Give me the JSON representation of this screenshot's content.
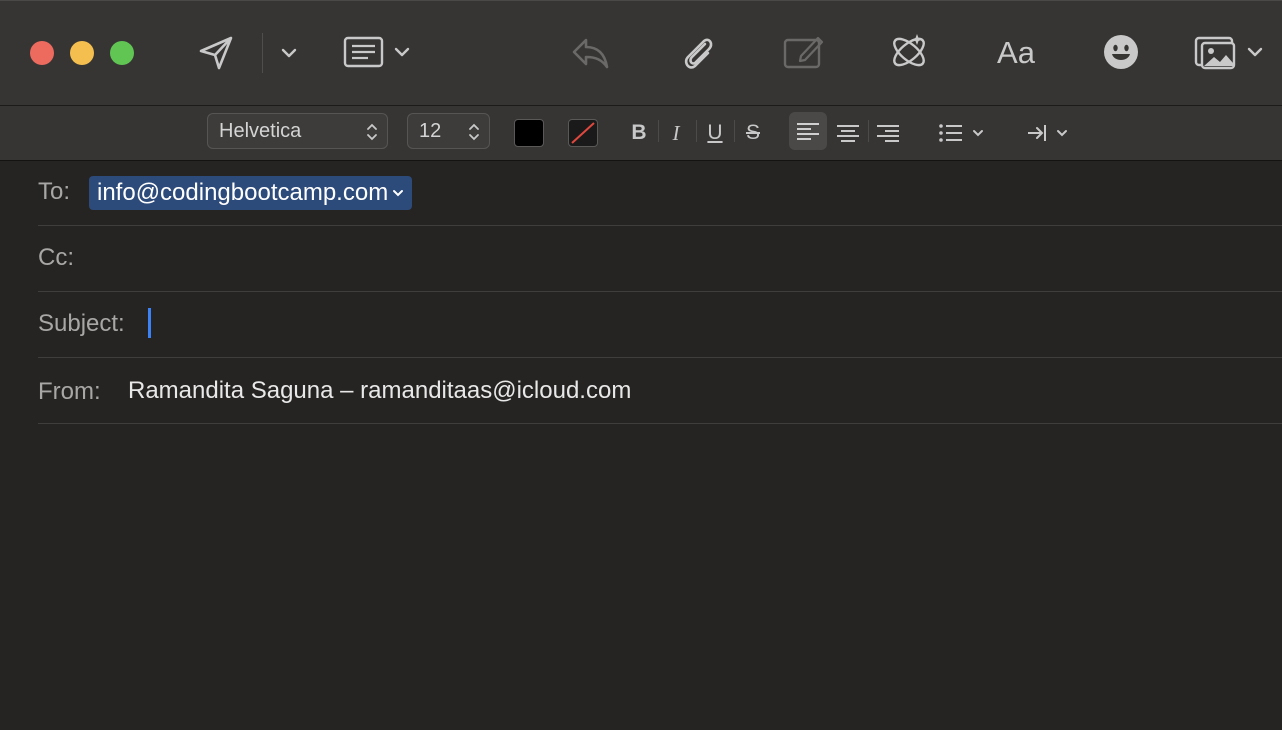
{
  "window": {
    "traffic_lights": {
      "close": "#ec6a5e",
      "minimize": "#f4bf4f",
      "maximize": "#61c554"
    }
  },
  "toolbar": {
    "icons": [
      "send-icon",
      "send-options-chevron-icon",
      "header-fields-icon",
      "reply-icon",
      "attachment-icon",
      "markup-icon",
      "writing-tools-icon",
      "format-icon",
      "emoji-icon",
      "photo-browser-icon"
    ],
    "format_label": "Aa"
  },
  "format_bar": {
    "font_family": "Helvetica",
    "font_size": "12",
    "text_color": "#000000",
    "bold": "B",
    "italic": "I",
    "underline": "U",
    "strikethrough": "S",
    "alignment": "left"
  },
  "fields": {
    "to_label": "To:",
    "to_value": "info@codingbootcamp.com",
    "cc_label": "Cc:",
    "cc_value": "",
    "subject_label": "Subject:",
    "subject_value": "",
    "from_label": "From:",
    "from_value": "Ramandita Saguna – ramanditaas@icloud.com"
  },
  "colors": {
    "background": "#262422",
    "toolbar": "#363534",
    "token": "#2c4a7a",
    "cursor": "#3b82f6"
  }
}
